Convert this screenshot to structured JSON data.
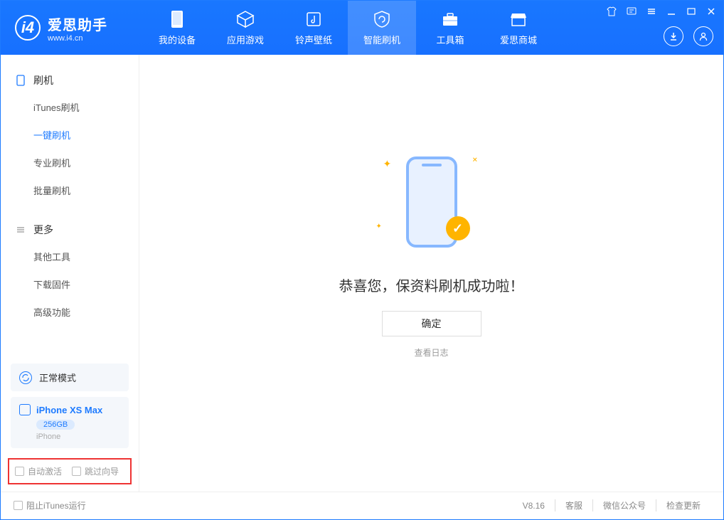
{
  "app": {
    "title": "爱思助手",
    "subtitle": "www.i4.cn"
  },
  "nav": {
    "mydevice": "我的设备",
    "apps": "应用游戏",
    "ring": "铃声壁纸",
    "flash": "智能刷机",
    "tools": "工具箱",
    "store": "爱思商城"
  },
  "sidebar": {
    "group_flash": "刷机",
    "items_flash": {
      "itunes": "iTunes刷机",
      "onekey": "一键刷机",
      "pro": "专业刷机",
      "batch": "批量刷机"
    },
    "group_more": "更多",
    "items_more": {
      "other": "其他工具",
      "firmware": "下载固件",
      "advanced": "高级功能"
    }
  },
  "mode": {
    "label": "正常模式"
  },
  "device": {
    "name": "iPhone XS Max",
    "storage": "256GB",
    "type": "iPhone"
  },
  "options": {
    "auto_activate": "自动激活",
    "skip_guide": "跳过向导"
  },
  "main": {
    "success": "恭喜您，保资料刷机成功啦！",
    "ok": "确定",
    "viewlog": "查看日志"
  },
  "footer": {
    "block_itunes": "阻止iTunes运行",
    "version": "V8.16",
    "support": "客服",
    "wechat": "微信公众号",
    "update": "检查更新"
  }
}
